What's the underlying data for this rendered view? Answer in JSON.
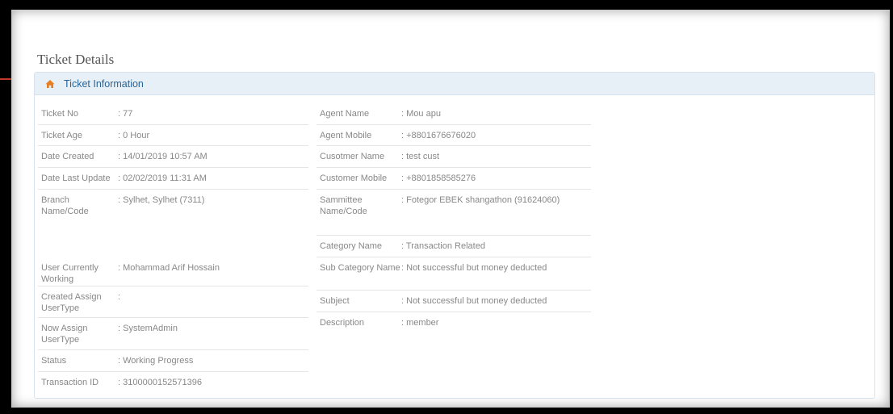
{
  "page": {
    "title": "Ticket Details"
  },
  "panel": {
    "title": "Ticket Information",
    "icon": "home-icon"
  },
  "left_fields": [
    {
      "label": "Ticket No",
      "value": "77"
    },
    {
      "label": "Ticket Age",
      "value": "0 Hour"
    },
    {
      "label": "Date Created",
      "value": "14/01/2019 10:57 AM"
    },
    {
      "label": "Date Last Update",
      "value": "02/02/2019 11:31 AM"
    },
    {
      "label": "Branch Name/Code",
      "value": "Sylhet, Sylhet (7311)"
    },
    {
      "label": "User Currently Working",
      "value": "Mohammad Arif Hossain"
    },
    {
      "label": "Created Assign UserType",
      "value": ""
    },
    {
      "label": "Now Assign UserType",
      "value": "SystemAdmin"
    },
    {
      "label": "Status",
      "value": "Working Progress"
    },
    {
      "label": "Transaction ID",
      "value": "3100000152571396"
    }
  ],
  "right_fields": [
    {
      "label": "Agent Name",
      "value": "Mou apu"
    },
    {
      "label": "Agent Mobile",
      "value": "+8801676676020"
    },
    {
      "label": "Cusotmer Name",
      "value": "test cust"
    },
    {
      "label": "Customer Mobile",
      "value": "+8801858585276"
    },
    {
      "label": "Sammittee Name/Code",
      "value": "Fotegor EBEK shangathon (91624060)"
    },
    {
      "label": "Category Name",
      "value": "Transaction Related"
    },
    {
      "label": "Sub Category Name",
      "value": "Not successful but money deducted"
    },
    {
      "label": "Subject",
      "value": "Not successful but money deducted"
    },
    {
      "label": "Description",
      "value": "member"
    }
  ]
}
